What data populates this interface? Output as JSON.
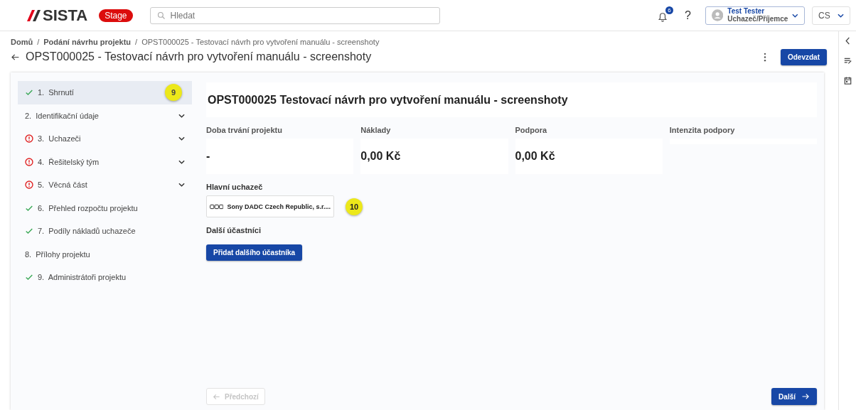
{
  "header": {
    "logo": "SISTA",
    "env_badge": "Stage",
    "search": {
      "placeholder": "Hledat"
    },
    "notifications": "6",
    "help": "?",
    "user": {
      "name": "Test Tester",
      "role": "Uchazeč/Příjemce"
    },
    "language": "CS"
  },
  "breadcrumb_separator": "/",
  "breadcrumbs": [
    "Domů",
    "Podání návrhu projektu",
    "OPST000025 - Testovací návrh pro vytvoření manuálu - screenshoty"
  ],
  "page_title": "OPST000025 - Testovací návrh pro vytvoření manuálu - screenshoty",
  "submit_button": "Odevzdat",
  "steps": [
    {
      "label": "1.  Shrnutí",
      "completed": true,
      "has_error": false,
      "expandable": false,
      "selected": true,
      "callout": "9"
    },
    {
      "label": "2.  Identifikační údaje",
      "completed": false,
      "has_error": false,
      "expandable": true,
      "selected": false
    },
    {
      "label": "3.  Uchazeči",
      "completed": false,
      "has_error": true,
      "expandable": true,
      "selected": false
    },
    {
      "label": "4.  Řešitelský tým",
      "completed": false,
      "has_error": true,
      "expandable": true,
      "selected": false
    },
    {
      "label": "5.  Věcná část",
      "completed": false,
      "has_error": true,
      "expandable": true,
      "selected": false
    },
    {
      "label": "6.  Přehled rozpočtu projektu",
      "completed": true,
      "has_error": false,
      "expandable": false,
      "selected": false
    },
    {
      "label": "7.  Podíly nákladů uchazeče",
      "completed": true,
      "has_error": false,
      "expandable": false,
      "selected": false
    },
    {
      "label": "8.  Přílohy projektu",
      "completed": false,
      "has_error": false,
      "expandable": false,
      "selected": false
    },
    {
      "label": "9.  Administrátoři projektu",
      "completed": true,
      "has_error": false,
      "expandable": false,
      "selected": false
    }
  ],
  "summary": {
    "title": "OPST000025 Testovací návrh pro vytvoření manuálu - screenshoty",
    "stats": [
      {
        "label": "Doba trvání projektu",
        "value": "-"
      },
      {
        "label": "Náklady",
        "value": "0,00 Kč"
      },
      {
        "label": "Podpora",
        "value": "0,00 Kč"
      },
      {
        "label": "Intenzita podpory"
      }
    ],
    "main_applicant_label": "Hlavní uchazeč",
    "main_applicant": "Sony DADC Czech Republic, s.r....",
    "main_applicant_callout": "10",
    "other_participants_label": "Další účastníci",
    "add_participant_button": "Přidat dalšího účastníka"
  },
  "nav": {
    "previous": "Předchozí",
    "previous_disabled": true,
    "next": "Další"
  }
}
